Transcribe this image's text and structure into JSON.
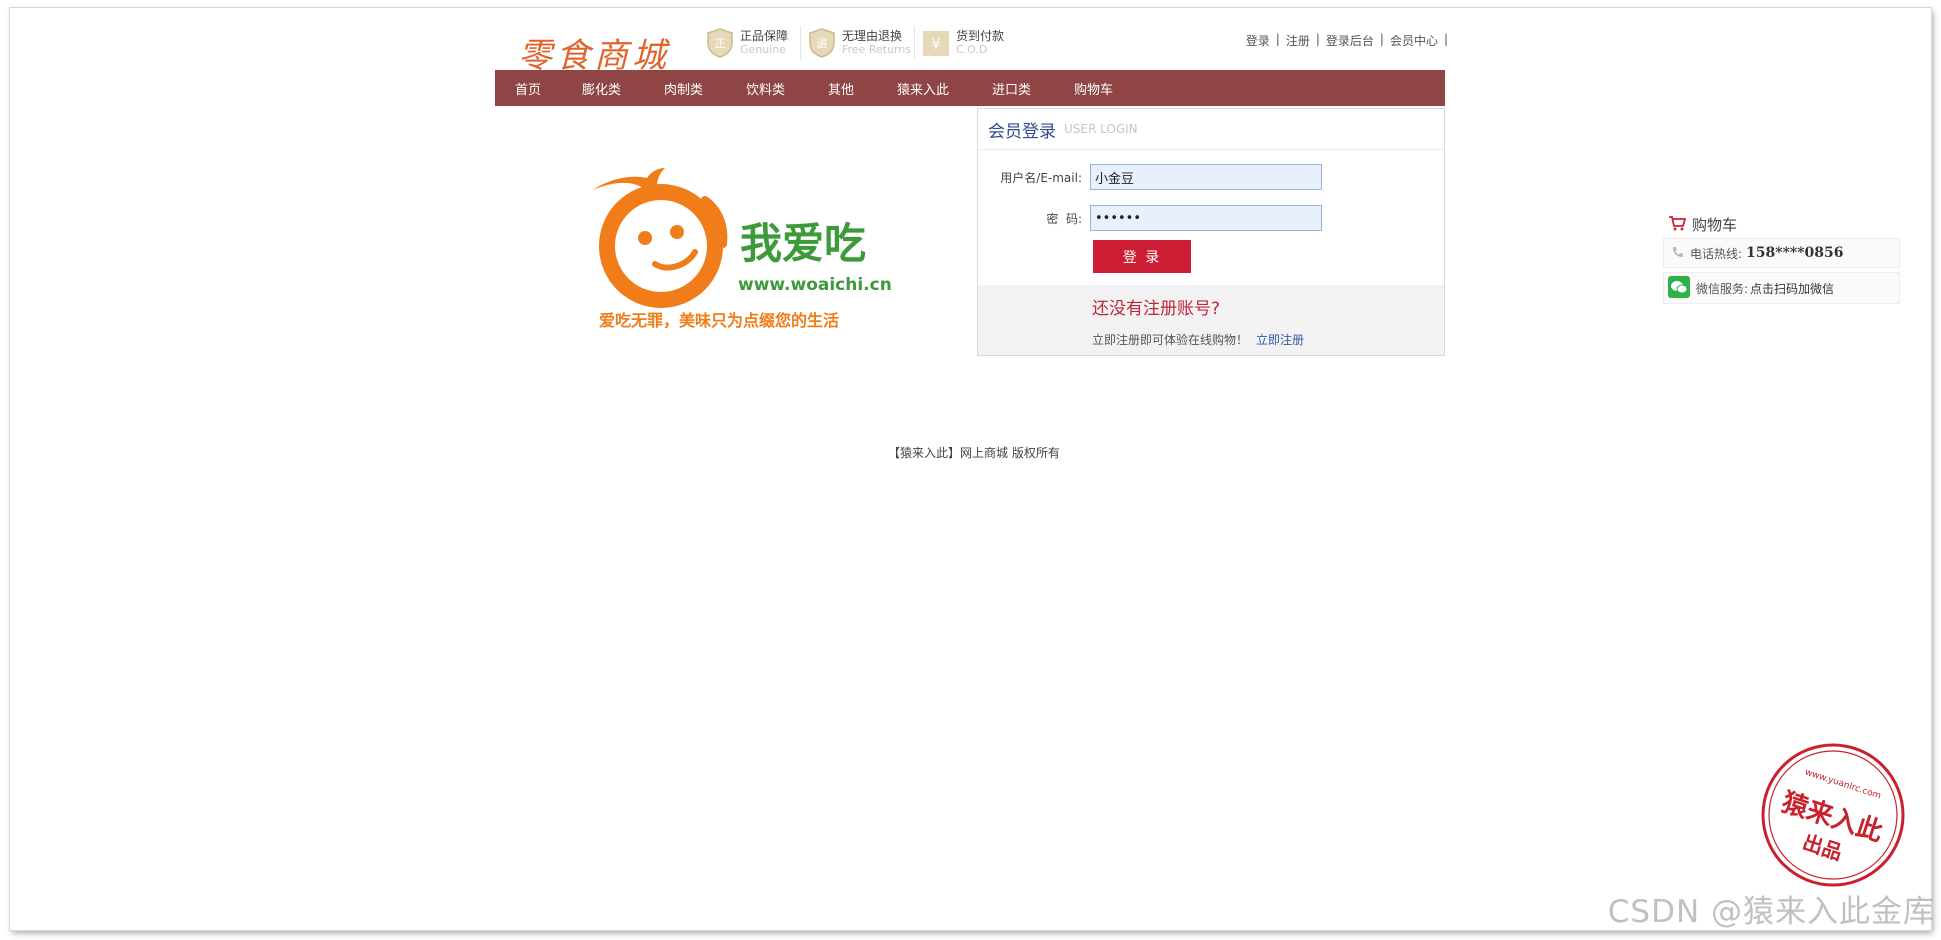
{
  "header": {
    "brand": "零食商城",
    "features": [
      {
        "icon": "genuine-shield-icon",
        "title": "正品保障",
        "subtitle": "Genuine"
      },
      {
        "icon": "return-shield-icon",
        "title": "无理由退换",
        "subtitle": "Free Returns"
      },
      {
        "icon": "cod-icon",
        "title": "货到付款",
        "subtitle": "C.O.D"
      }
    ],
    "links": [
      "登录",
      "注册",
      "登录后台",
      "会员中心"
    ],
    "separator": "|"
  },
  "nav": {
    "items": [
      "首页",
      "膨化类",
      "肉制类",
      "饮料类",
      "其他",
      "猿来入此",
      "进口类",
      "购物车"
    ]
  },
  "logo": {
    "name": "我爱吃",
    "url": "www.woaichi.cn",
    "slogan": "爱吃无罪，美味只为点缀您的生活"
  },
  "login": {
    "title": "会员登录",
    "title_en": "USER LOGIN",
    "username_label": "用户名/E-mail:",
    "username_value": "小金豆",
    "password_label": "密  码:",
    "password_value": "••••••",
    "submit": "登 录",
    "no_account": "还没有注册账号?",
    "register_hint": "立即注册即可体验在线购物！",
    "register_link": "立即注册"
  },
  "footer": {
    "text": "【猿来入此】网上商城 版权所有"
  },
  "side": {
    "cart": "购物车",
    "hotline_label": "电话热线:",
    "hotline": "158****0856",
    "wechat_label": "微信服务:",
    "wechat_value": "点击扫码加微信"
  },
  "stamp": {
    "top": "www.yuanlrc.com",
    "main": "猿来入此",
    "sub": "出品"
  },
  "watermark": "CSDN @猿来入此金库",
  "colors": {
    "nav_bg": "#8e4543",
    "brand": "#e0642c",
    "button": "#cc1f35",
    "link": "#2c5aa8",
    "logo_orange": "#f07d1a",
    "logo_green": "#3d9a3a"
  }
}
